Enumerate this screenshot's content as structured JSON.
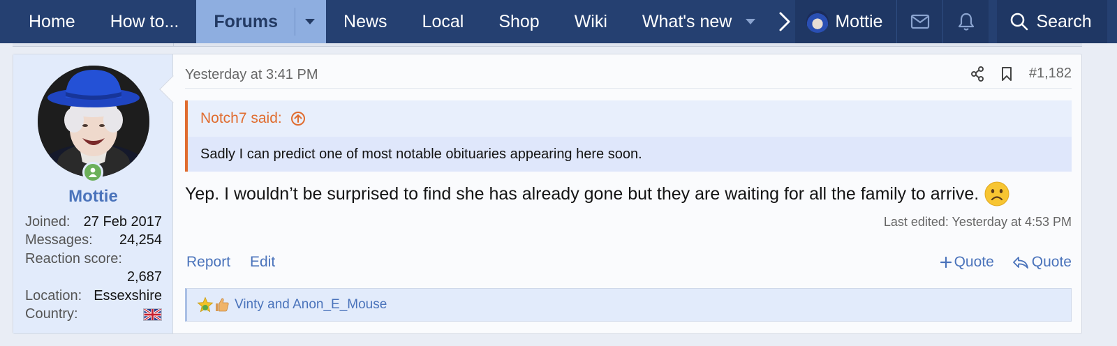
{
  "nav": {
    "items": [
      {
        "label": "Home"
      },
      {
        "label": "How to..."
      },
      {
        "label": "Forums"
      },
      {
        "label": "News"
      },
      {
        "label": "Local"
      },
      {
        "label": "Shop"
      },
      {
        "label": "Wiki"
      },
      {
        "label": "What's new"
      }
    ],
    "user": "Mottie",
    "search_label": "Search",
    "colors": {
      "bar": "#254071",
      "active": "#8eaee0"
    }
  },
  "post": {
    "timestamp": "Yesterday at 3:41 PM",
    "number": "#1,182",
    "author": {
      "name": "Mottie",
      "joined_label": "Joined:",
      "joined": "27 Feb 2017",
      "messages_label": "Messages:",
      "messages": "24,254",
      "reaction_label": "Reaction score:",
      "reaction": "2,687",
      "location_label": "Location:",
      "location": "Essexshire",
      "country_label": "Country:",
      "country_icon": "uk-flag-icon"
    },
    "quote": {
      "attribution": "Notch7 said:",
      "text": "Sadly I can predict one of most notable obituaries appearing here soon."
    },
    "body": "Yep. I wouldn’t be surprised to find she has already gone but they are waiting for all the family to arrive.",
    "last_edited": "Last edited: Yesterday at 4:53 PM",
    "actions": {
      "report": "Report",
      "edit": "Edit",
      "multi_quote": "Quote",
      "reply_quote": "Quote"
    },
    "reactions": {
      "users": "Vinty and Anon_E_Mouse",
      "icons": [
        "star-reaction-icon",
        "like-reaction-icon"
      ]
    },
    "colors": {
      "link": "#4a73bb",
      "quote_accent": "#e06c2f",
      "online": "#6cb05a"
    }
  }
}
